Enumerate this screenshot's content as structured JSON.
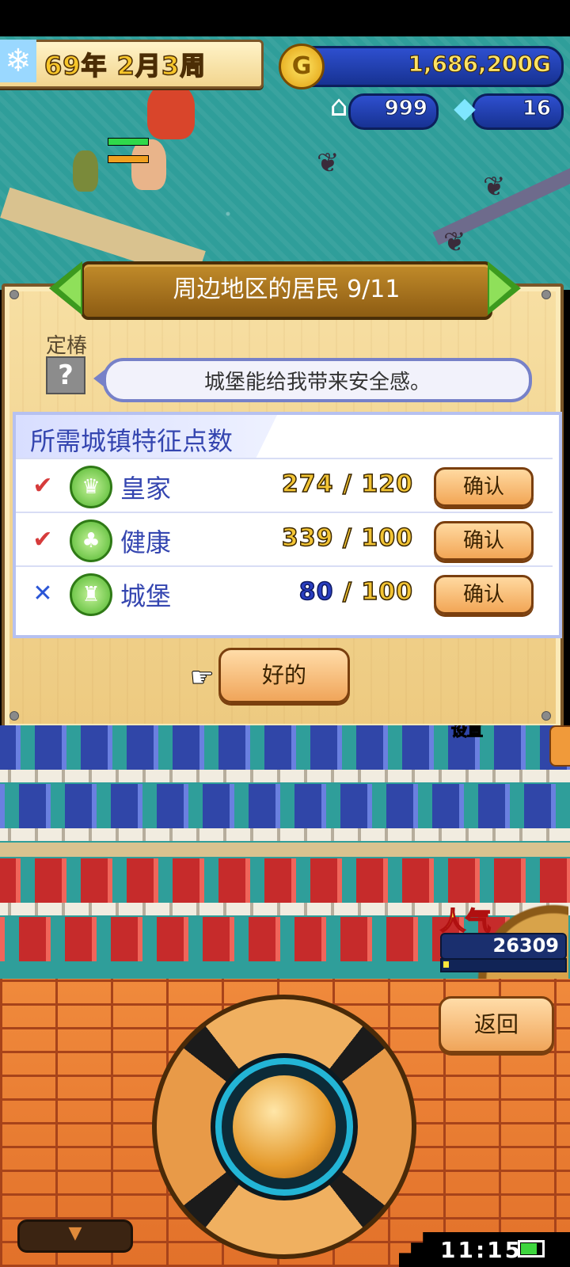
{
  "hud": {
    "date": "69年 2月3周",
    "gold": "1,686,200G",
    "population": "999",
    "crystals": "16",
    "gold_icon_letter": "G",
    "snow_icon": "snowflake-icon",
    "population_icon": "house-icon",
    "crystal_icon": "crystal-icon"
  },
  "dialog": {
    "title": "周边地区的居民 9/11",
    "resident_name": "定椿",
    "avatar_symbol": "?",
    "speech": "城堡能给我带来安全感。",
    "requirements_header": "所需城镇特征点数",
    "requirements": [
      {
        "status": "✔",
        "met": true,
        "icon": "crown-icon",
        "icon_glyph": "♛",
        "name": "皇家",
        "current": "274",
        "required": "120",
        "button": "确认"
      },
      {
        "status": "✔",
        "met": true,
        "icon": "health-icon",
        "icon_glyph": "♣",
        "name": "健康",
        "current": "339",
        "required": "100",
        "button": "确认"
      },
      {
        "status": "✕",
        "met": false,
        "icon": "castle-icon",
        "icon_glyph": "♜",
        "name": "城堡",
        "current": "80",
        "required": "100",
        "button": "确认"
      }
    ],
    "ok_button": "好的"
  },
  "town": {
    "popularity_label": "人气",
    "popularity_score": "26309",
    "popularity_fraction": 0.05,
    "cut_label": "设直"
  },
  "controls": {
    "back_button": "返回",
    "menu_tab_glyph": "▼"
  },
  "system": {
    "clock": "11:15"
  },
  "colors": {
    "accent_blue": "#3546b0",
    "ok_mark": "#d63b3b",
    "fail_mark": "#2a55d6",
    "button_orange": "#f0a55a"
  }
}
